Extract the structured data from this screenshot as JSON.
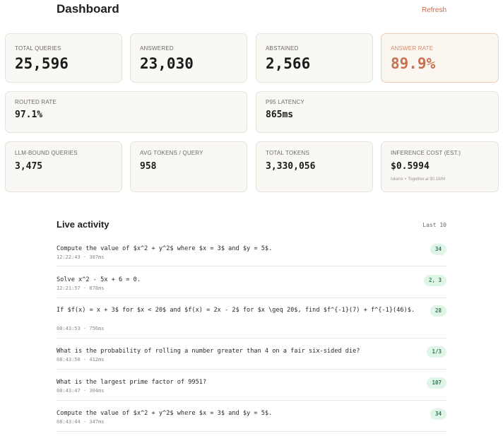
{
  "header": {
    "title": "Dashboard",
    "refresh_label": "Refresh"
  },
  "stats": {
    "total_queries": {
      "label": "TOTAL QUERIES",
      "value": "25,596"
    },
    "answered": {
      "label": "ANSWERED",
      "value": "23,030"
    },
    "abstained": {
      "label": "ABSTAINED",
      "value": "2,566"
    },
    "answer_rate": {
      "label": "ANSWER RATE",
      "value": "89.9%"
    },
    "routed_rate": {
      "label": "ROUTED RATE",
      "value": "97.1%"
    },
    "p95_latency": {
      "label": "P95 LATENCY",
      "value": "865ms"
    },
    "llm_bound": {
      "label": "LLM-BOUND QUERIES",
      "value": "3,475"
    },
    "avg_tokens": {
      "label": "AVG TOKENS / QUERY",
      "value": "958"
    },
    "total_tokens": {
      "label": "TOTAL TOKENS",
      "value": "3,330,056"
    },
    "inference_cost": {
      "label": "INFERENCE COST (EST.)",
      "value": "$0.5994",
      "note": "tokens × Together.ai $0.18/M"
    }
  },
  "activity": {
    "title": "Live activity",
    "meta": "Last 10",
    "items": [
      {
        "question": "Compute the value of $x^2 + y^2$ where $x = 3$ and $y = 5$.",
        "meta": "12:22:43 · 387ms",
        "answer": "34"
      },
      {
        "question": "Solve x^2 - 5x + 6 = 0.",
        "meta": "12:21:57 · 878ms",
        "answer": "2, 3"
      },
      {
        "question": "If $f(x) = x + 3$ for $x < 20$ and $f(x) = 2x - 2$ for $x \\geq 20$, find $f^{-1}(7) + f^{-1}(46)$.",
        "meta": "08:43:53 · 756ms",
        "answer": "28"
      },
      {
        "question": "What is the probability of rolling a number greater than 4 on a fair six-sided die?",
        "meta": "08:43:50 · 412ms",
        "answer": "1/3"
      },
      {
        "question": "What is the largest prime factor of 9951?",
        "meta": "08:43:47 · 304ms",
        "answer": "107"
      },
      {
        "question": "Compute the value of $x^2 + y^2$ where $x = 3$ and $y = 5$.",
        "meta": "08:43:44 · 347ms",
        "answer": "34"
      }
    ]
  }
}
